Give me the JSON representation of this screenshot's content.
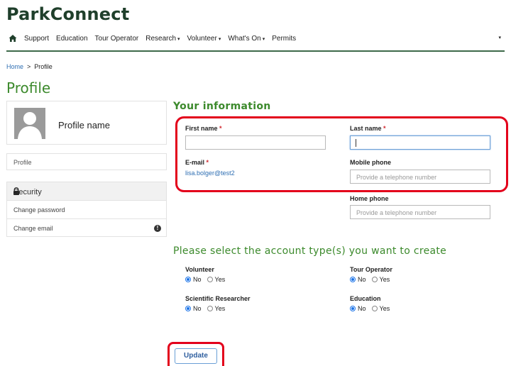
{
  "app": {
    "brand": "ParkConnect"
  },
  "nav": {
    "items": [
      {
        "label": "Support",
        "dropdown": false
      },
      {
        "label": "Education",
        "dropdown": false
      },
      {
        "label": "Tour Operator",
        "dropdown": false
      },
      {
        "label": "Research",
        "dropdown": true
      },
      {
        "label": "Volunteer",
        "dropdown": true
      },
      {
        "label": "What's On",
        "dropdown": true
      },
      {
        "label": "Permits",
        "dropdown": false
      }
    ],
    "caret": "▾"
  },
  "breadcrumb": {
    "home": "Home",
    "separator": ">",
    "current": "Profile"
  },
  "page": {
    "title": "Profile"
  },
  "sidebar": {
    "profile_name": "Profile name",
    "profile_link": "Profile",
    "security_header": "Security",
    "change_password": "Change password",
    "change_email": "Change email",
    "info_glyph": "!"
  },
  "form": {
    "section_title": "Your information",
    "required_mark": "*",
    "first_name": {
      "label": "First name",
      "value": ""
    },
    "last_name": {
      "label": "Last name",
      "value": ""
    },
    "email": {
      "label": "E-mail",
      "value": "lisa.bolger@test2"
    },
    "mobile_phone": {
      "label": "Mobile phone",
      "placeholder": "Provide a telephone number"
    },
    "home_phone": {
      "label": "Home phone",
      "placeholder": "Provide a telephone number"
    }
  },
  "account_types": {
    "title": "Please select the account type(s) you want to create",
    "no_label": "No",
    "yes_label": "Yes",
    "items": [
      {
        "label": "Volunteer",
        "selected": "No"
      },
      {
        "label": "Tour Operator",
        "selected": "No"
      },
      {
        "label": "Scientific Researcher",
        "selected": "No"
      },
      {
        "label": "Education",
        "selected": "No"
      }
    ]
  },
  "actions": {
    "update_label": "Update"
  },
  "colors": {
    "brand": "#1f3f2b",
    "accent_green": "#3c8a2c",
    "link_blue": "#2f6fb3",
    "highlight_red": "#e3001b"
  }
}
